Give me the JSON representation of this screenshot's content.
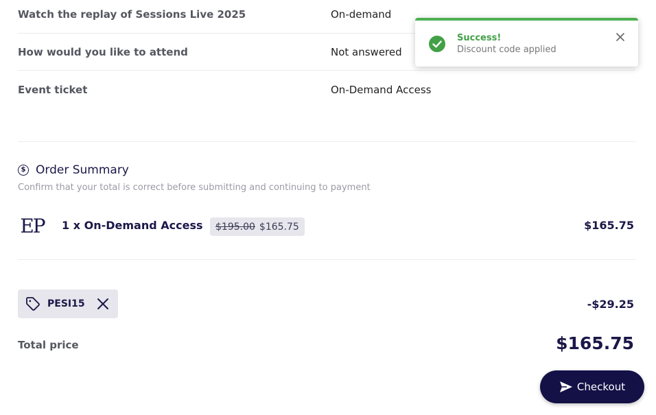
{
  "questions": [
    {
      "label": "Watch the replay of Sessions Live 2025",
      "answer": "On-demand"
    },
    {
      "label": "How would you like to attend",
      "answer": "Not answered"
    },
    {
      "label": "Event ticket",
      "answer": "On-Demand Access"
    }
  ],
  "summary": {
    "icon": "dollar-circle-icon",
    "title": "Order Summary",
    "subtitle": "Confirm that your total is correct before submitting and continuing to payment"
  },
  "item": {
    "logo_text": "EP",
    "name": "1 x On-Demand Access",
    "old_price": "$195.00",
    "new_price": "$165.75",
    "line_total": "$165.75"
  },
  "coupon": {
    "code": "PESI15",
    "icon": "tag-icon",
    "remove_icon": "close-icon",
    "discount": "-$29.25"
  },
  "total": {
    "label": "Total price",
    "value": "$165.75"
  },
  "checkout": {
    "label": "Checkout",
    "icon": "send-icon"
  },
  "toast": {
    "title": "Success!",
    "message": "Discount code applied",
    "status_color": "#43a047"
  }
}
